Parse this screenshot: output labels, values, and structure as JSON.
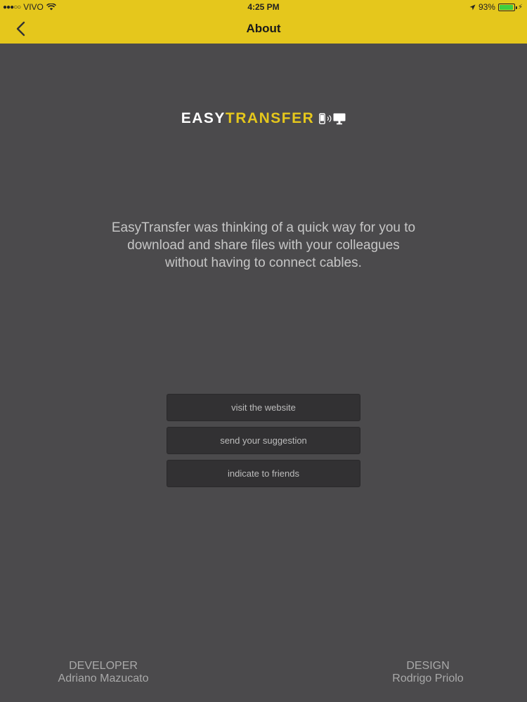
{
  "status_bar": {
    "carrier": "VIVO",
    "signal_dots": "●●●○○",
    "time": "4:25 PM",
    "battery_percent": "93%",
    "battery_level": 0.93
  },
  "nav": {
    "title": "About"
  },
  "logo": {
    "part1": "EASY",
    "part2": "TRANSFER"
  },
  "description": "EasyTransfer was thinking of a quick way for you to download and share files with your colleagues without having to connect cables.",
  "buttons": {
    "website": "visit the website",
    "suggestion": "send your suggestion",
    "friends": "indicate to friends"
  },
  "credits": {
    "developer_role": "DEVELOPER",
    "developer_name": "Adriano Mazucato",
    "design_role": "DESIGN",
    "design_name": "Rodrigo Priolo"
  },
  "colors": {
    "accent": "#e5c71c",
    "background": "#4b4a4c",
    "button": "#323133"
  }
}
